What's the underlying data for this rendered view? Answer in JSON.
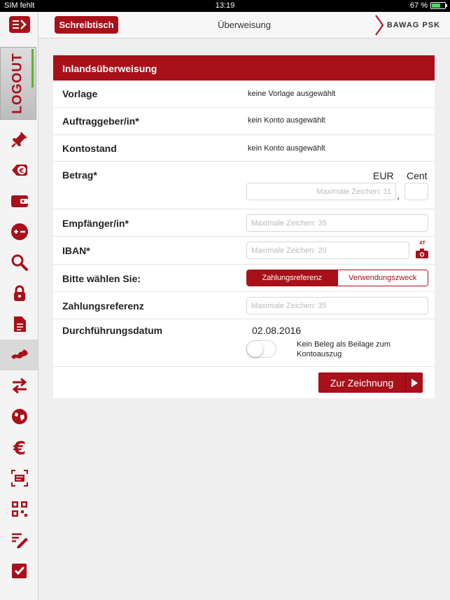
{
  "status": {
    "carrier": "SIM fehlt",
    "time": "13:19",
    "battery": "67 %",
    "battery_level": 0.67
  },
  "sidebar": {
    "logout_label": "LOGOUT",
    "icons": [
      "pin-icon",
      "euro-coin-icon",
      "wallet-icon",
      "plus-minus-icon",
      "search-icon",
      "lock-icon",
      "document-icon",
      "austria-map-icon",
      "transfer-arrows-icon",
      "globe-icon",
      "euro-icon",
      "scan-icon",
      "qr-code-icon",
      "sign-pen-icon",
      "checkbox-icon"
    ],
    "active_index": 7
  },
  "header": {
    "desk_button": "Schreibtisch",
    "title": "Überweisung",
    "brand": "BAWAG PSK"
  },
  "form": {
    "title": "Inlandsüberweisung",
    "vorlage": {
      "label": "Vorlage",
      "value": "keine Vorlage ausgewählt"
    },
    "auftraggeber": {
      "label": "Auftraggeber/in*",
      "value": "kein Konto ausgewählt"
    },
    "kontostand": {
      "label": "Kontostand",
      "value": "kein Konto ausgewählt"
    },
    "betrag": {
      "label": "Betrag*",
      "eur_label": "EUR",
      "cent_label": "Cent",
      "eur_placeholder": "Maximale Zeichen: 11",
      "separator": ","
    },
    "empfaenger": {
      "label": "Empfänger/in*",
      "placeholder": "Maximale Zeichen: 35"
    },
    "iban": {
      "label": "IBAN*",
      "placeholder": "Maximale Zeichen: 20",
      "camera_badge": "AT"
    },
    "choice": {
      "label": "Bitte wählen Sie:",
      "option_selected": "Zahlungsreferenz",
      "option_other": "Verwendungszweck"
    },
    "zahlungsreferenz": {
      "label": "Zahlungsreferenz",
      "placeholder": "Maximale Zeichen: 35"
    },
    "datum": {
      "label": "Durchführungsdatum",
      "value": "02.08.2016",
      "toggle_label": "Kein Beleg als Beilage zum Kontoauszug",
      "toggle_on": false
    },
    "submit": "Zur Zeichnung"
  },
  "colors": {
    "brand": "#a8101a",
    "accent_green": "#5db12e"
  }
}
